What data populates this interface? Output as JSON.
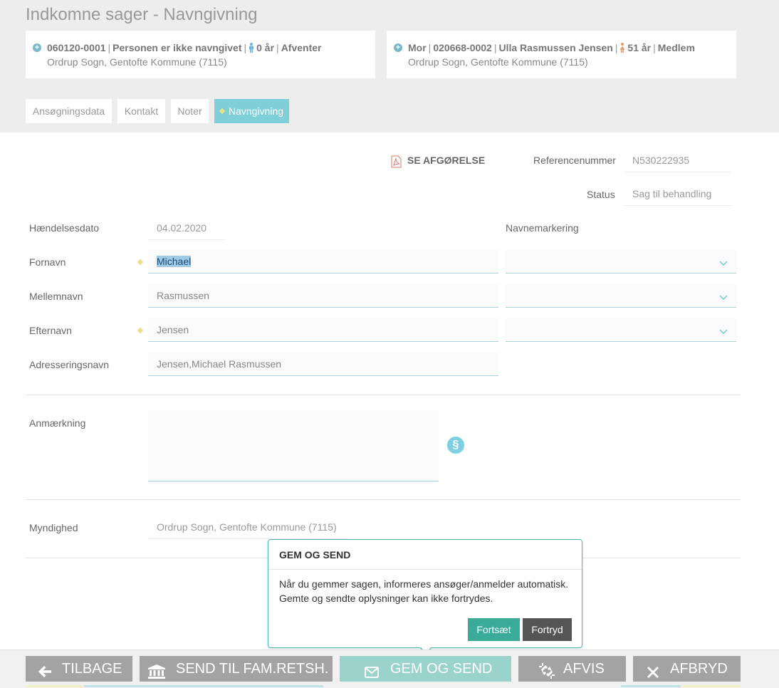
{
  "page": {
    "title": "Indkomne sager - Navngivning"
  },
  "persons": [
    {
      "id": "060120-0001",
      "name": "Personen er ikke navngivet",
      "age": "0 år",
      "status": "Afventer",
      "location": "Ordrup Sogn, Gentofte Kommune (7115)",
      "gender_icon": "male-icon"
    },
    {
      "relation": "Mor",
      "id": "020668-0002",
      "name": "Ulla Rasmussen Jensen",
      "age": "51 år",
      "status": "Medlem",
      "location": "Ordrup Sogn, Gentofte Kommune (7115)",
      "gender_icon": "female-icon"
    }
  ],
  "tabs": [
    {
      "label": "Ansøgningsdata"
    },
    {
      "label": "Kontakt"
    },
    {
      "label": "Noter"
    },
    {
      "label": "Navngivning",
      "active": true
    }
  ],
  "decision": {
    "label": "SE AFGØRELSE"
  },
  "reference": {
    "label": "Referencenummer",
    "value": "N530222935"
  },
  "status": {
    "label": "Status",
    "value": "Sag til behandling"
  },
  "form": {
    "event_date": {
      "label": "Hændelsesdato",
      "value": "04.02.2020"
    },
    "name_marking": {
      "label": "Navnemarkering"
    },
    "first_name": {
      "label": "Fornavn",
      "value": "Michael"
    },
    "middle_name": {
      "label": "Mellemnavn",
      "value": "Rasmussen"
    },
    "last_name": {
      "label": "Efternavn",
      "value": "Jensen"
    },
    "address_name": {
      "label": "Adresseringsnavn",
      "value": "Jensen,Michael Rasmussen"
    },
    "remark": {
      "label": "Anmærkning",
      "value": ""
    },
    "authority": {
      "label": "Myndighed",
      "value": "Ordrup Sogn, Gentofte Kommune (7115)"
    }
  },
  "popup": {
    "title": "GEM OG SEND",
    "line1": "Når du gemmer sagen, informeres ansøger/anmelder automatisk.",
    "line2": "Gemte og sendte oplysninger kan ikke fortrydes.",
    "continue_label": "Fortsæt",
    "cancel_label": "Fortryd"
  },
  "bottom_bar": [
    {
      "label": "TILBAGE",
      "icon": "arrow-left-icon"
    },
    {
      "label": "SEND TIL FAM.RETSH.",
      "icon": "bank-icon"
    },
    {
      "label": "GEM OG SEND",
      "icon": "envelope-icon"
    },
    {
      "label": "AFVIS",
      "icon": "broken-link-icon"
    },
    {
      "label": "AFBRYD",
      "icon": "close-icon"
    }
  ],
  "colors": {
    "accent": "#7fcfd8",
    "button_gray": "#a3a3a3",
    "continue": "#3aaa99",
    "cancel": "#555555",
    "save_send": "#9ad3cb"
  }
}
